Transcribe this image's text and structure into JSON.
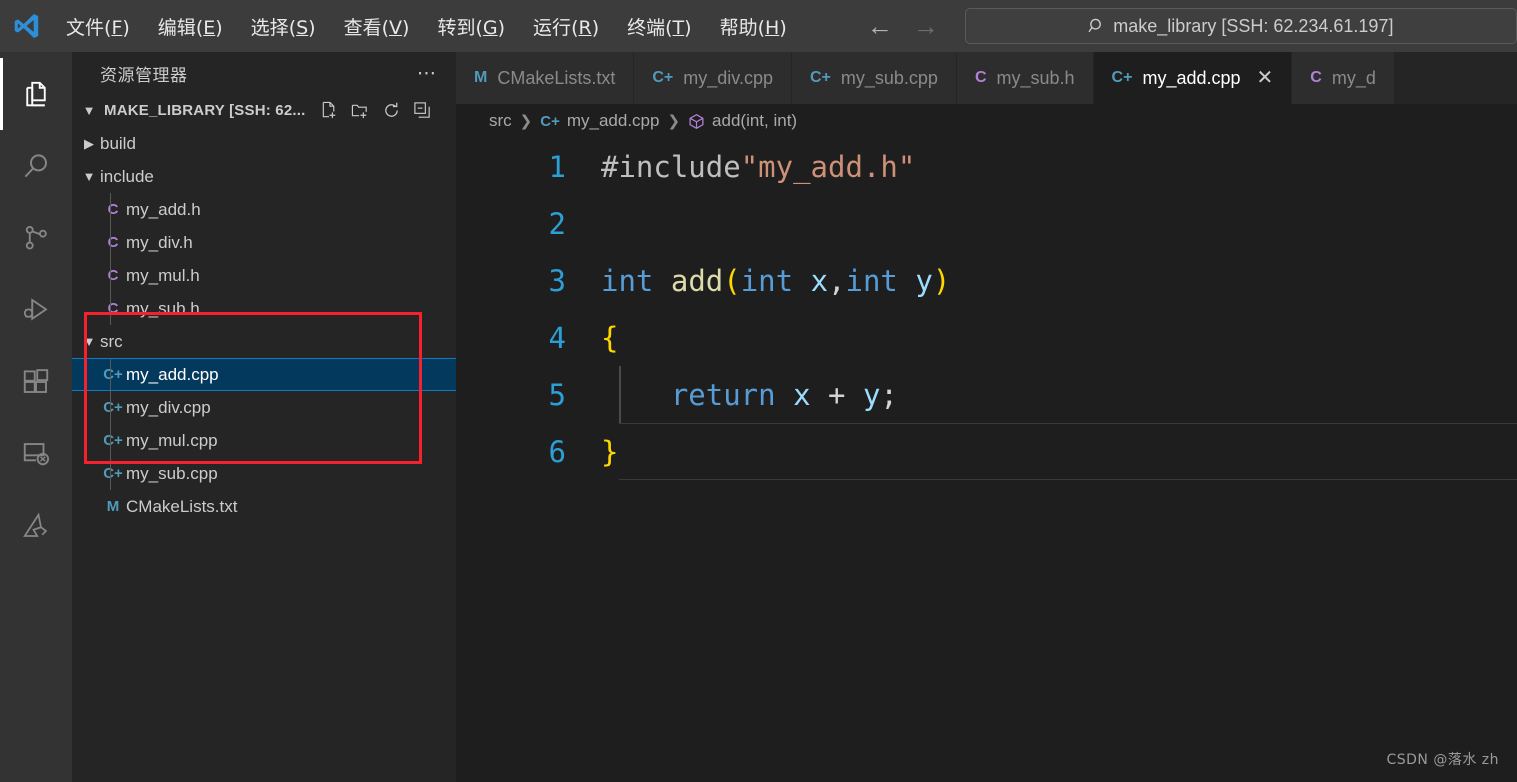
{
  "titlebar": {
    "logo_icon": "vscode-logo-icon",
    "menus": [
      {
        "label": "文件",
        "mnemonic": "F"
      },
      {
        "label": "编辑",
        "mnemonic": "E"
      },
      {
        "label": "选择",
        "mnemonic": "S"
      },
      {
        "label": "查看",
        "mnemonic": "V"
      },
      {
        "label": "转到",
        "mnemonic": "G"
      },
      {
        "label": "运行",
        "mnemonic": "R"
      },
      {
        "label": "终端",
        "mnemonic": "T"
      },
      {
        "label": "帮助",
        "mnemonic": "H"
      }
    ],
    "back_icon": "arrow-left-icon",
    "forward_icon": "arrow-right-icon",
    "search": {
      "icon": "search-icon",
      "value": "make_library [SSH: 62.234.61.197]",
      "placeholder": "make_library [SSH: 62.234.61.197]"
    }
  },
  "activitybar": {
    "items": [
      {
        "name": "explorer",
        "icon": "files-icon",
        "active": true
      },
      {
        "name": "search",
        "icon": "search-icon",
        "active": false
      },
      {
        "name": "source-control",
        "icon": "source-control-icon",
        "active": false
      },
      {
        "name": "run-and-debug",
        "icon": "run-debug-icon",
        "active": false
      },
      {
        "name": "extensions",
        "icon": "extensions-icon",
        "active": false
      },
      {
        "name": "remote-explorer",
        "icon": "remote-explorer-icon",
        "active": false
      },
      {
        "name": "platformio",
        "icon": "platformio-icon",
        "active": false
      }
    ]
  },
  "sidebar": {
    "title": "资源管理器",
    "more_actions_icon": "ellipsis-icon",
    "root": {
      "label": "MAKE_LIBRARY [SSH: 62...",
      "expanded": true,
      "caret_icon": "chevron-down-icon",
      "actions": [
        {
          "name": "new-file",
          "icon": "new-file-icon"
        },
        {
          "name": "new-folder",
          "icon": "new-folder-icon"
        },
        {
          "name": "refresh",
          "icon": "refresh-icon"
        },
        {
          "name": "collapse-all",
          "icon": "collapse-all-icon"
        }
      ]
    },
    "tree": [
      {
        "label": "build",
        "type": "folder",
        "expanded": false,
        "indent": 1,
        "icon": "chevron-right-icon",
        "selected": false
      },
      {
        "label": "include",
        "type": "folder",
        "expanded": true,
        "indent": 1,
        "icon": "chevron-down-icon",
        "selected": false
      },
      {
        "label": "my_add.h",
        "type": "c-header",
        "indent": 2,
        "icon": "C",
        "selected": false
      },
      {
        "label": "my_div.h",
        "type": "c-header",
        "indent": 2,
        "icon": "C",
        "selected": false
      },
      {
        "label": "my_mul.h",
        "type": "c-header",
        "indent": 2,
        "icon": "C",
        "selected": false
      },
      {
        "label": "my_sub.h",
        "type": "c-header",
        "indent": 2,
        "icon": "C",
        "selected": false
      },
      {
        "label": "src",
        "type": "folder",
        "expanded": true,
        "indent": 1,
        "icon": "chevron-down-icon",
        "selected": false
      },
      {
        "label": "my_add.cpp",
        "type": "cpp-source",
        "indent": 2,
        "icon": "C+",
        "selected": true
      },
      {
        "label": "my_div.cpp",
        "type": "cpp-source",
        "indent": 2,
        "icon": "C+",
        "selected": false
      },
      {
        "label": "my_mul.cpp",
        "type": "cpp-source",
        "indent": 2,
        "icon": "C+",
        "selected": false
      },
      {
        "label": "my_sub.cpp",
        "type": "cpp-source",
        "indent": 2,
        "icon": "C+",
        "selected": false
      },
      {
        "label": "CMakeLists.txt",
        "type": "cmake",
        "indent": 1,
        "icon": "M",
        "selected": false
      }
    ],
    "annotation": {
      "shape": "rectangle",
      "color": "#f5222d",
      "encloses": "src folder and its cpp files"
    }
  },
  "editor": {
    "tabs": [
      {
        "label": "CMakeLists.txt",
        "icon": "M",
        "icon_kind": "cmake",
        "active": false,
        "closable": false
      },
      {
        "label": "my_div.cpp",
        "icon": "C+",
        "icon_kind": "cpp-source",
        "active": false,
        "closable": false
      },
      {
        "label": "my_sub.cpp",
        "icon": "C+",
        "icon_kind": "cpp-source",
        "active": false,
        "closable": false
      },
      {
        "label": "my_sub.h",
        "icon": "C",
        "icon_kind": "c-header",
        "active": false,
        "closable": false
      },
      {
        "label": "my_add.cpp",
        "icon": "C+",
        "icon_kind": "cpp-source",
        "active": true,
        "closable": true,
        "close_icon": "close-icon"
      },
      {
        "label": "my_d",
        "icon": "C",
        "icon_kind": "c-header",
        "active": false,
        "closable": false
      }
    ],
    "breadcrumb": [
      {
        "label": "src",
        "icon": null
      },
      {
        "label": "my_add.cpp",
        "icon": "C+",
        "icon_kind": "cpp-source"
      },
      {
        "label": "add(int, int)",
        "icon": "symbol-method-icon",
        "icon_kind": "symbol"
      }
    ],
    "code_lines": [
      {
        "num": "1",
        "current": false,
        "indent_guide": false,
        "tokens": [
          {
            "t": "#include",
            "c": "t-pp"
          },
          {
            "t": "\"my_add.h\"",
            "c": "t-str"
          }
        ]
      },
      {
        "num": "2",
        "current": false,
        "indent_guide": false,
        "tokens": []
      },
      {
        "num": "3",
        "current": false,
        "indent_guide": false,
        "tokens": [
          {
            "t": "int",
            "c": "t-kw"
          },
          {
            "t": " ",
            "c": "t-plain"
          },
          {
            "t": "add",
            "c": "t-fn"
          },
          {
            "t": "(",
            "c": "t-brkt-y"
          },
          {
            "t": "int",
            "c": "t-kw"
          },
          {
            "t": " ",
            "c": "t-plain"
          },
          {
            "t": "x",
            "c": "t-var"
          },
          {
            "t": ",",
            "c": "t-punc"
          },
          {
            "t": "int",
            "c": "t-kw"
          },
          {
            "t": " ",
            "c": "t-plain"
          },
          {
            "t": "y",
            "c": "t-var"
          },
          {
            "t": ")",
            "c": "t-brkt-y"
          }
        ]
      },
      {
        "num": "4",
        "current": false,
        "indent_guide": false,
        "tokens": [
          {
            "t": "{",
            "c": "t-brkt-y"
          }
        ]
      },
      {
        "num": "5",
        "current": false,
        "indent_guide": true,
        "tokens": [
          {
            "t": "    ",
            "c": "t-plain"
          },
          {
            "t": "return",
            "c": "t-ctl"
          },
          {
            "t": " ",
            "c": "t-plain"
          },
          {
            "t": "x",
            "c": "t-var"
          },
          {
            "t": " + ",
            "c": "t-plain"
          },
          {
            "t": "y",
            "c": "t-var"
          },
          {
            "t": ";",
            "c": "t-punc"
          }
        ]
      },
      {
        "num": "6",
        "current": true,
        "indent_guide": false,
        "tokens": [
          {
            "t": "}",
            "c": "t-brkt-y"
          }
        ]
      }
    ]
  },
  "watermark": "CSDN @落水 zh",
  "colors": {
    "titlebar_bg": "#3c3c3c",
    "activitybar_bg": "#333333",
    "sidebar_bg": "#252526",
    "editor_bg": "#1e1e1e",
    "tab_inactive_bg": "#2d2d2d",
    "selection_bg": "#04395e",
    "selection_border": "#0f7bbd",
    "annotation": "#f5222d",
    "linenumber": "#2b9fd6"
  }
}
